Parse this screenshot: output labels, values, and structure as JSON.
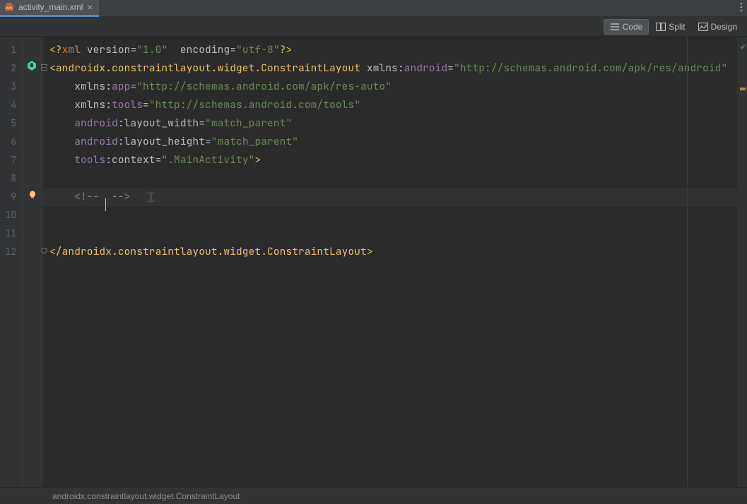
{
  "tab": {
    "filename": "activity_main.xml"
  },
  "toolbar": {
    "code": "Code",
    "split": "Split",
    "design": "Design"
  },
  "status": {
    "breadcrumb": "androidx.constraintlayout.widget.ConstraintLayout"
  },
  "gutter": {
    "lines": [
      "1",
      "2",
      "3",
      "4",
      "5",
      "6",
      "7",
      "8",
      "9",
      "10",
      "11",
      "12"
    ]
  },
  "code": {
    "l1": {
      "pre": "<?",
      "xml": "xml",
      "sp1": " ",
      "ver_k": "version",
      "eq": "=",
      "ver_v": "\"1.0\"",
      "sp2": "  ",
      "enc_k": "encoding",
      "enc_v": "\"utf-8\"",
      "post": "?>"
    },
    "l2": {
      "lt": "<",
      "tag": "androidx.constraintlayout.widget.ConstraintLayout",
      "sp": " ",
      "ns": "xmlns:",
      "nsk": "android",
      "eq": "=",
      "val": "\"http://schemas.android.com/apk/res/android\""
    },
    "l3": {
      "indent": "    ",
      "ns": "xmlns:",
      "nsk": "app",
      "eq": "=",
      "val": "\"http://schemas.android.com/apk/res-auto\""
    },
    "l4": {
      "indent": "    ",
      "ns": "xmlns:",
      "nsk": "tools",
      "eq": "=",
      "val": "\"http://schemas.android.com/tools\""
    },
    "l5": {
      "indent": "    ",
      "pfx": "android",
      "col": ":",
      "attr": "layout_width",
      "eq": "=",
      "val": "\"match_parent\""
    },
    "l6": {
      "indent": "    ",
      "pfx": "android",
      "col": ":",
      "attr": "layout_height",
      "eq": "=",
      "val": "\"match_parent\""
    },
    "l7": {
      "indent": "    ",
      "pfx": "tools",
      "col": ":",
      "attr": "context",
      "eq": "=",
      "val": "\".MainActivity\"",
      "end": ">"
    },
    "l9": {
      "indent": "    ",
      "open": "<!-- ",
      "close": " -->"
    },
    "l12": {
      "lt": "</",
      "tag": "androidx.constraintlayout.widget.ConstraintLayout",
      "gt": ">"
    }
  }
}
